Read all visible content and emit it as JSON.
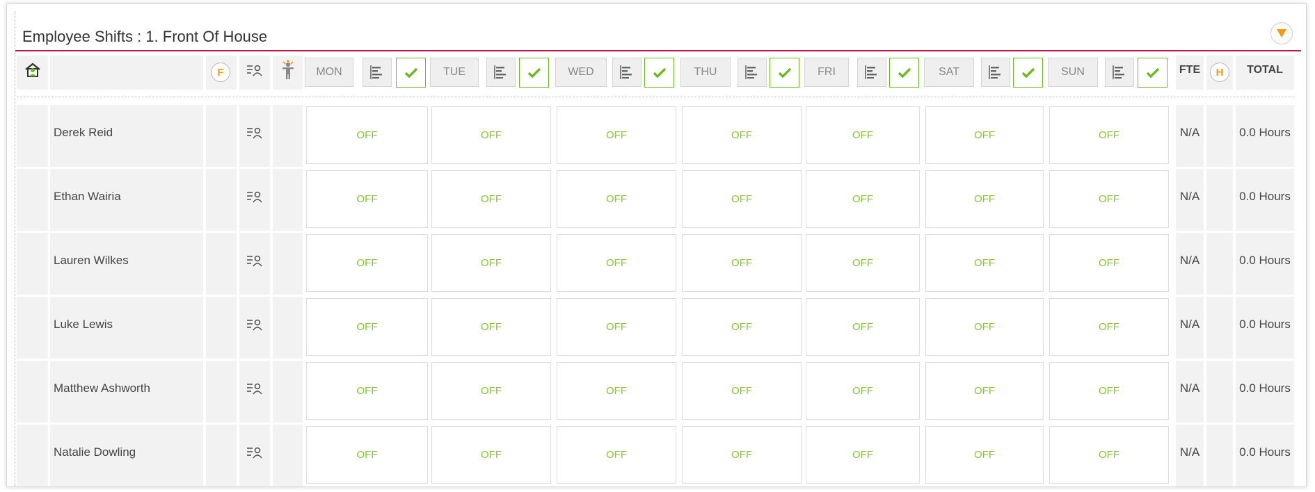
{
  "panel": {
    "title": "Employee Shifts : 1. Front Of House"
  },
  "colors": {
    "accent": "#c0184d",
    "off_text": "#86c23a",
    "check_border": "#6cba20",
    "badge": "#f39a12"
  },
  "header": {
    "f_badge": "F",
    "h_badge": "H",
    "fte_label": "FTE",
    "total_label": "TOTAL",
    "icons": [
      "home-people-icon",
      "employee-list-icon",
      "person-award-icon",
      "sort-bars-icon",
      "checkmark-icon"
    ]
  },
  "days": [
    {
      "label": "MON"
    },
    {
      "label": "TUE"
    },
    {
      "label": "WED"
    },
    {
      "label": "THU"
    },
    {
      "label": "FRI"
    },
    {
      "label": "SAT"
    },
    {
      "label": "SUN"
    }
  ],
  "employees": [
    {
      "name": "Derek Reid",
      "shifts": [
        "OFF",
        "OFF",
        "OFF",
        "OFF",
        "OFF",
        "OFF",
        "OFF"
      ],
      "fte": "N/A",
      "total": "0.0 Hours"
    },
    {
      "name": "Ethan Wairia",
      "shifts": [
        "OFF",
        "OFF",
        "OFF",
        "OFF",
        "OFF",
        "OFF",
        "OFF"
      ],
      "fte": "N/A",
      "total": "0.0 Hours"
    },
    {
      "name": "Lauren Wilkes",
      "shifts": [
        "OFF",
        "OFF",
        "OFF",
        "OFF",
        "OFF",
        "OFF",
        "OFF"
      ],
      "fte": "N/A",
      "total": "0.0 Hours"
    },
    {
      "name": "Luke Lewis",
      "shifts": [
        "OFF",
        "OFF",
        "OFF",
        "OFF",
        "OFF",
        "OFF",
        "OFF"
      ],
      "fte": "N/A",
      "total": "0.0 Hours"
    },
    {
      "name": "Matthew Ashworth",
      "shifts": [
        "OFF",
        "OFF",
        "OFF",
        "OFF",
        "OFF",
        "OFF",
        "OFF"
      ],
      "fte": "N/A",
      "total": "0.0 Hours"
    },
    {
      "name": "Natalie Dowling",
      "shifts": [
        "OFF",
        "OFF",
        "OFF",
        "OFF",
        "OFF",
        "OFF",
        "OFF"
      ],
      "fte": "N/A",
      "total": "0.0 Hours"
    }
  ]
}
